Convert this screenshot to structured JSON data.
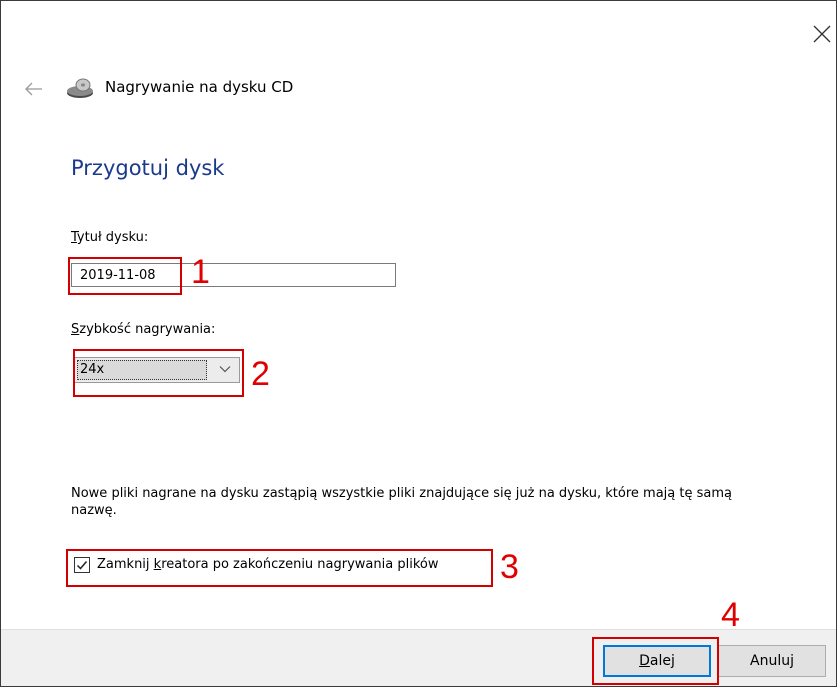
{
  "window": {
    "title": "Nagrywanie na dysku CD",
    "heading": "Przygotuj dysk",
    "close_icon": "close-icon",
    "back_icon": "back-arrow-icon",
    "cd_icon": "cd-drive-icon"
  },
  "form": {
    "disc_title_label_hotkey": "T",
    "disc_title_label_rest": "ytuł dysku:",
    "disc_title_value": "2019-11-08",
    "speed_label_hotkey": "S",
    "speed_label_rest": "zybkość nagrywania:",
    "speed_value": "24x"
  },
  "info": {
    "text": "Nowe pliki nagrane na dysku zastąpią wszystkie pliki znajdujące się już na dysku, które mają tę samą nazwę."
  },
  "checkbox": {
    "checked": true,
    "label_pre": "Zamknij ",
    "label_hotkey": "k",
    "label_post": "reatora po zakończeniu nagrywania plików"
  },
  "buttons": {
    "next_hotkey": "D",
    "next_rest": "alej",
    "cancel": "Anuluj"
  },
  "annotations": {
    "color": "#d20000",
    "labels": [
      "1",
      "2",
      "3",
      "4"
    ]
  }
}
